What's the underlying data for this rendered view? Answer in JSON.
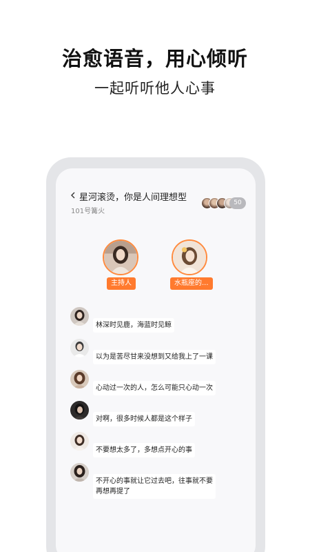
{
  "promo": {
    "headline": "治愈语音，用心倾听",
    "subline": "一起听听他人心事"
  },
  "room": {
    "title": "星河滚烫，你是人间理想型",
    "subtitle": "101号篝火",
    "audience_count": "50",
    "back_icon": "chevron-left-icon"
  },
  "seats": [
    {
      "label": "主持人"
    },
    {
      "label": "水瓶座的..."
    }
  ],
  "messages": [
    {
      "text": "林深时见鹿，海蓝时见鲸"
    },
    {
      "text": "以为是苦尽甘来没想到又给我上了一课"
    },
    {
      "text": "心动过一次的人，怎么可能只心动一次"
    },
    {
      "text": "对啊，很多时候人都是这个样子"
    },
    {
      "text": "不要想太多了，多想点开心的事"
    },
    {
      "text": "不开心的事就让它过去吧，往事就不要\n再想再提了"
    }
  ],
  "colors": {
    "accent": "#ff7a2e",
    "phone_frame": "#e4e5e8",
    "screen_bg": "#f8f8fa"
  }
}
